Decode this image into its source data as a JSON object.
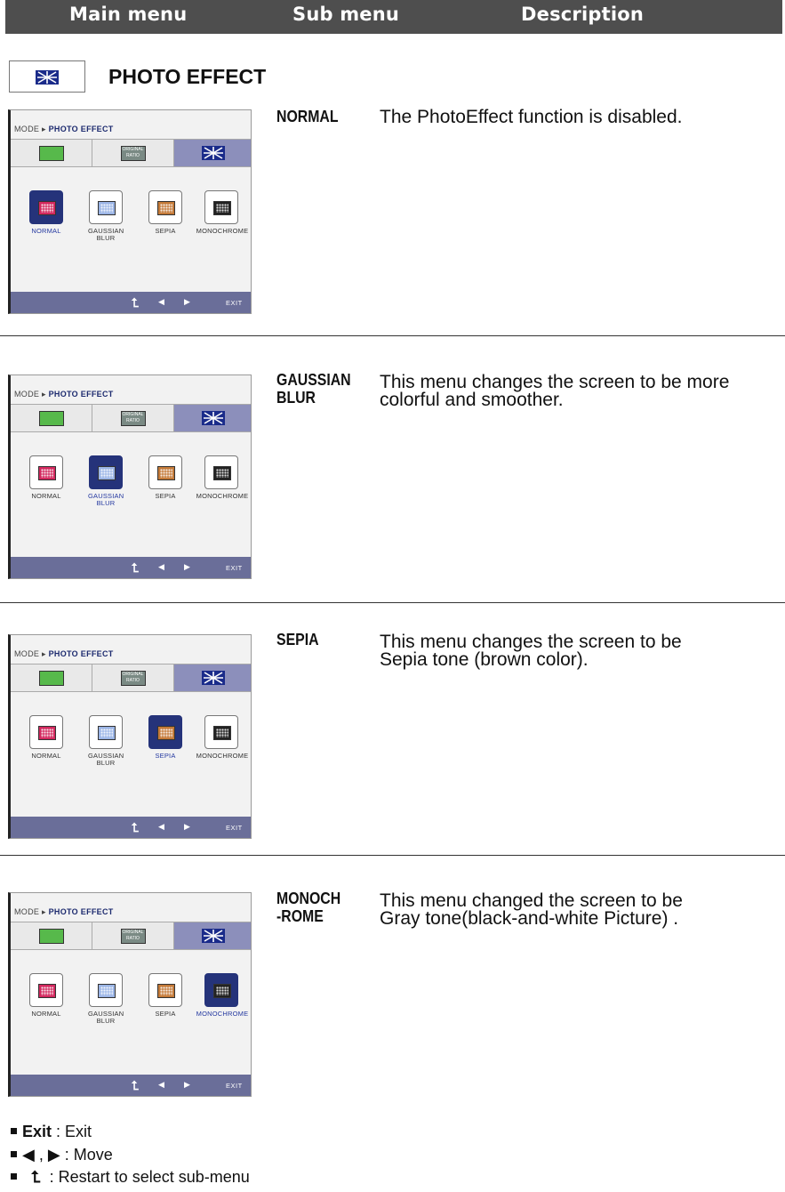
{
  "header": {
    "main_menu": "Main menu",
    "sub_menu": "Sub menu",
    "description": "Description"
  },
  "section": {
    "title": "PHOTO EFFECT"
  },
  "panel_ui": {
    "breadcrumb_mode": "MODE",
    "breadcrumb_current": "PHOTO EFFECT",
    "ratio_icon_text": "ORIGINAL RATIO",
    "options": [
      "NORMAL",
      "GAUSSIAN BLUR",
      "SEPIA",
      "MONOCHROME"
    ],
    "exit": "EXIT"
  },
  "entries": [
    {
      "sub_menu": "NORMAL",
      "description": "The PhotoEffect function is disabled.",
      "selected_option": "NORMAL"
    },
    {
      "sub_menu_line1": "GAUSSIAN",
      "sub_menu_line2": "BLUR",
      "description_line1": "This menu changes the screen to be more",
      "description_line2": "colorful and smoother.",
      "selected_option": "GAUSSIAN BLUR"
    },
    {
      "sub_menu": "SEPIA",
      "description_line1": "This menu changes the screen to be",
      "description_line2": "Sepia tone (brown color).",
      "selected_option": "SEPIA"
    },
    {
      "sub_menu_line1": "MONOCH",
      "sub_menu_line2": "-ROME",
      "description_line1": "This menu changed the screen to be",
      "description_line2": "Gray tone(black-and-white Picture) .",
      "selected_option": "MONOCHROME"
    }
  ],
  "legend": {
    "exit_label": "Exit",
    "exit_text": ": Exit",
    "move_symbols": "◀ , ▶",
    "move_text": ": Move",
    "restart_symbol": "⮤",
    "restart_text": ": Restart to select sub-menu"
  },
  "colors": {
    "header_bg": "#4e4e4e",
    "selected_option": "#25337a",
    "footer_bar": "#6a6e99",
    "active_tab": "#8c8fbb"
  }
}
